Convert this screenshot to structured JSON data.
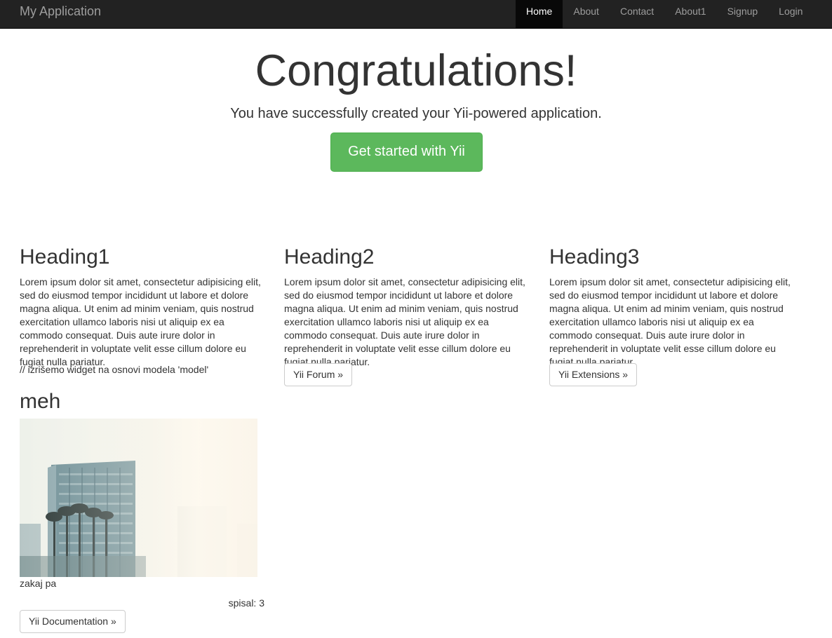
{
  "navbar": {
    "brand": "My Application",
    "items": [
      {
        "label": "Home",
        "active": true
      },
      {
        "label": "About",
        "active": false
      },
      {
        "label": "Contact",
        "active": false
      },
      {
        "label": "About1",
        "active": false
      },
      {
        "label": "Signup",
        "active": false
      },
      {
        "label": "Login",
        "active": false
      }
    ]
  },
  "jumbotron": {
    "title": "Congratulations!",
    "lead": "You have successfully created your Yii-powered application.",
    "button": "Get started with Yii"
  },
  "columns": [
    {
      "heading": "Heading1",
      "body": "Lorem ipsum dolor sit amet, consectetur adipisicing elit, sed do eiusmod tempor incididunt ut labore et dolore magna aliqua. Ut enim ad minim veniam, quis nostrud exercitation ullamco laboris nisi ut aliquip ex ea commodo consequat. Duis aute irure dolor in reprehenderit in voluptate velit esse cillum dolore eu fugiat nulla pariatur.",
      "button": "Yii Documentation »"
    },
    {
      "heading": "Heading2",
      "body": "Lorem ipsum dolor sit amet, consectetur adipisicing elit, sed do eiusmod tempor incididunt ut labore et dolore magna aliqua. Ut enim ad minim veniam, quis nostrud exercitation ullamco laboris nisi ut aliquip ex ea commodo consequat. Duis aute irure dolor in reprehenderit in voluptate velit esse cillum dolore eu fugiat nulla pariatur.",
      "button": "Yii Forum »"
    },
    {
      "heading": "Heading3",
      "body": "Lorem ipsum dolor sit amet, consectetur adipisicing elit, sed do eiusmod tempor incididunt ut labore et dolore magna aliqua. Ut enim ad minim veniam, quis nostrud exercitation ullamco laboris nisi ut aliquip ex ea commodo consequat. Duis aute irure dolor in reprehenderit in voluptate velit esse cillum dolore eu fugiat nulla pariatur.",
      "button": "Yii Extensions »"
    }
  ],
  "widget": {
    "comment": "// izrišemo widget na osnovi modela 'model'",
    "title": "meh",
    "caption": "zakaj pa",
    "author": "spisal: 3"
  },
  "colors": {
    "navbar_bg": "#222222",
    "nav_active_bg": "#080808",
    "success": "#5cb85c",
    "text": "#333333"
  }
}
